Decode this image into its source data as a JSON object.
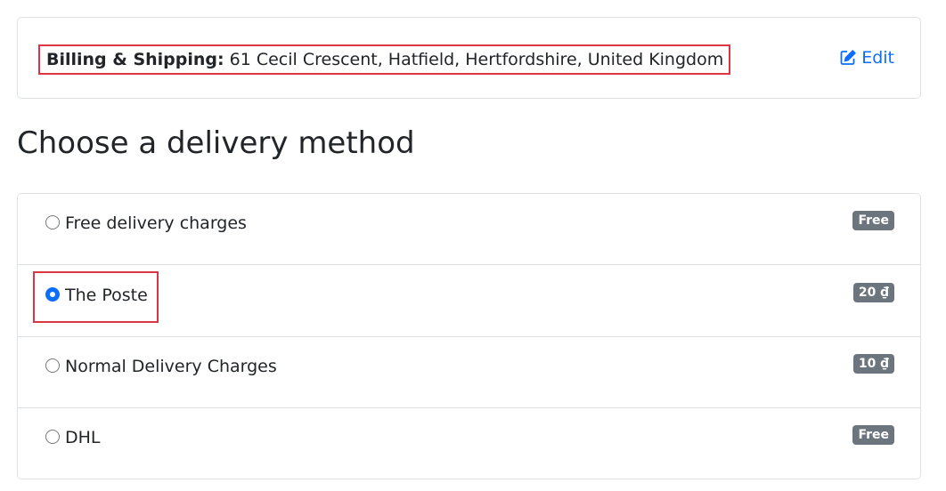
{
  "address": {
    "label": "Billing & Shipping:",
    "value": "61 Cecil Crescent, Hatfield, Hertfordshire, United Kingdom",
    "edit_label": "Edit",
    "edit_icon": "edit-icon"
  },
  "heading": "Choose a delivery method",
  "delivery_methods": [
    {
      "name": "Free delivery charges",
      "price": "Free",
      "selected": false
    },
    {
      "name": "The Poste",
      "price": "20 ₫",
      "selected": true
    },
    {
      "name": "Normal Delivery Charges",
      "price": "10 ₫",
      "selected": false
    },
    {
      "name": "DHL",
      "price": "Free",
      "selected": false
    }
  ],
  "colors": {
    "accent": "#0d6efd",
    "highlight_border": "#dc3545",
    "badge_bg": "#6c757d"
  }
}
